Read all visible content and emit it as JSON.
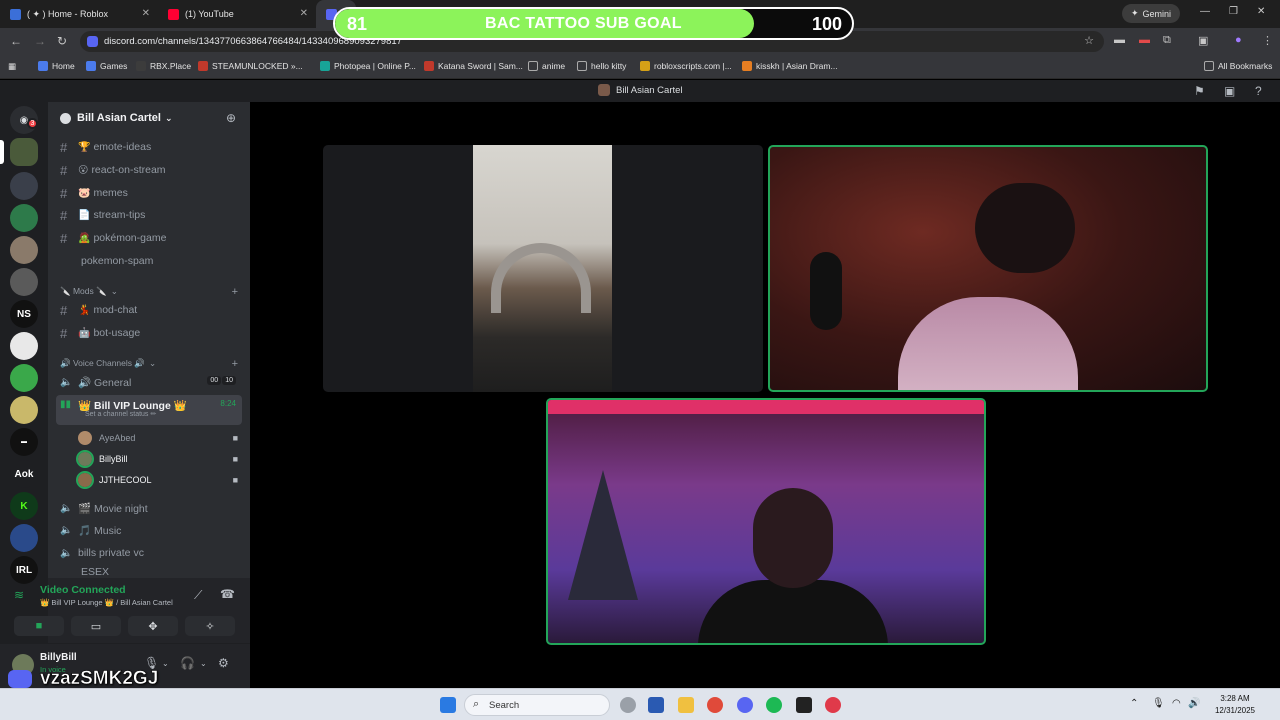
{
  "browser": {
    "tabs": [
      {
        "title": "( ✦ ) Home - Roblox",
        "color": "#3b6fd8"
      },
      {
        "title": "(1) YouTube",
        "color": "#ff0033"
      },
      {
        "title": "",
        "color": "#5865f2"
      }
    ],
    "gemini_label": "Gemini",
    "url": "discord.com/channels/1343770663864766484/1433409689093279817",
    "bookmarks": [
      {
        "label": "Home",
        "color": "#4b7bec"
      },
      {
        "label": "Games",
        "color": "#4b7bec"
      },
      {
        "label": "RBX.Place",
        "color": "#3c3c3c"
      },
      {
        "label": "STEAMUNLOCKED »...",
        "color": "#c0392b"
      },
      {
        "label": "Photopea | Online P...",
        "color": "#18a497"
      },
      {
        "label": "Katana Sword | Sam...",
        "color": "#c0392b"
      },
      {
        "label": "anime",
        "color": "#888888"
      },
      {
        "label": "hello kitty",
        "color": "#888888"
      },
      {
        "label": "robloxscripts.com |...",
        "color": "#d4a017"
      },
      {
        "label": "kisskh | Asian Dram...",
        "color": "#e67e22"
      }
    ],
    "all_bookmarks": "All Bookmarks"
  },
  "overlay": {
    "start": "81",
    "title": "BAC TATTOO SUB GOAL",
    "end": "100",
    "progress": 0.81
  },
  "discord": {
    "title": "Bill Asian Cartel",
    "server_badge": "3",
    "server_name": "Bill Asian Cartel",
    "rail_labels": [
      "NS",
      "Aok",
      "IRL"
    ],
    "text_channels": [
      {
        "emoji": "🏆",
        "name": "emote-ideas"
      },
      {
        "emoji": "😮",
        "name": "react-on-stream"
      },
      {
        "emoji": "🐷",
        "name": "memes"
      },
      {
        "emoji": "📄",
        "name": "stream-tips"
      },
      {
        "emoji": "🧟",
        "name": "pokémon-game"
      },
      {
        "emoji": "",
        "name": "pokemon-spam"
      }
    ],
    "mods_category": "🔪 Mods 🔪",
    "mods_channels": [
      {
        "emoji": "💃",
        "name": "mod-chat"
      },
      {
        "emoji": "🤖",
        "name": "bot-usage"
      }
    ],
    "voice_category": "🔊 Voice Channels 🔊",
    "voice_general": {
      "name": "🔊 General",
      "count_a": "00",
      "count_b": "10"
    },
    "active_voice": {
      "name": "👑 Bill VIP Lounge 👑",
      "status": "Set a channel status ✏",
      "timer": "8:24"
    },
    "voice_users": [
      {
        "name": "AyeAbed",
        "color": "#b08b6a"
      },
      {
        "name": "BillyBill",
        "color": "#6d7a5a"
      },
      {
        "name": "JJTHECOOL",
        "color": "#8a6a4a"
      }
    ],
    "more_voice": [
      {
        "name": "🎬 Movie night"
      },
      {
        "name": "🎵 Music"
      },
      {
        "name": "bills private vc"
      },
      {
        "name": "ESEX"
      }
    ],
    "voice_connected": "Video Connected",
    "voice_location": "👑 Bill VIP Lounge 👑 / Bill Asian Cartel",
    "user": {
      "name": "BillyBill",
      "status": "In voice"
    },
    "watermark": "vzazSMK2GJ"
  },
  "taskbar": {
    "search_placeholder": "Search",
    "time": "3:28 AM",
    "date": "12/31/2025"
  }
}
